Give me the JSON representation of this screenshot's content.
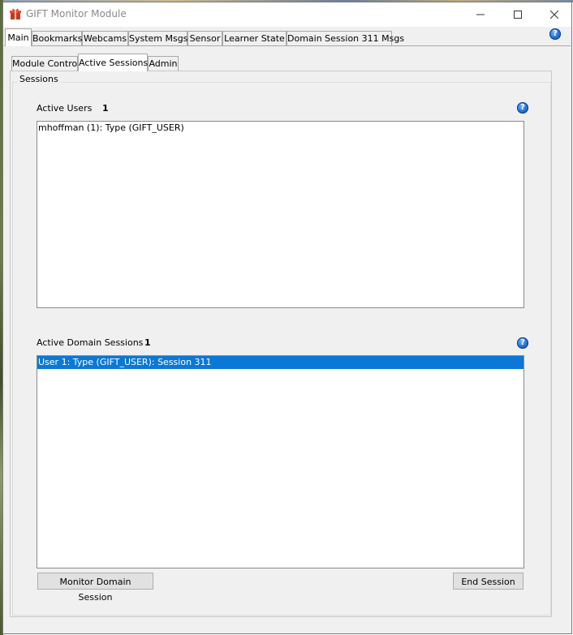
{
  "window": {
    "title": "GIFT Monitor Module"
  },
  "main_tabs": [
    {
      "label": "Main",
      "active": true
    },
    {
      "label": "Bookmarks",
      "active": false
    },
    {
      "label": "Webcams",
      "active": false
    },
    {
      "label": "System Msgs",
      "active": false
    },
    {
      "label": "Sensor",
      "active": false
    },
    {
      "label": "Learner State",
      "active": false
    },
    {
      "label": "Domain Session 311 Msgs",
      "active": false
    }
  ],
  "sub_tabs": [
    {
      "label": "Module Control",
      "active": false
    },
    {
      "label": "Active Sessions",
      "active": true
    },
    {
      "label": "Admin",
      "active": false
    }
  ],
  "help_icon_glyph": "?",
  "sessions_group": {
    "label": "Sessions",
    "active_users": {
      "label": "Active Users",
      "count": "1",
      "items": [
        "mhoffman (1): Type (GIFT_USER)"
      ]
    },
    "active_domain_sessions": {
      "label": "Active Domain Sessions",
      "count": "1",
      "items": [
        "User 1: Type (GIFT_USER): Session 311"
      ],
      "selected_index": 0
    }
  },
  "buttons": {
    "monitor_domain_session": "Monitor Domain Session",
    "end_session": "End Session"
  },
  "colors": {
    "selection": "#0a78d7",
    "help_icon": "#1e6fd0"
  }
}
